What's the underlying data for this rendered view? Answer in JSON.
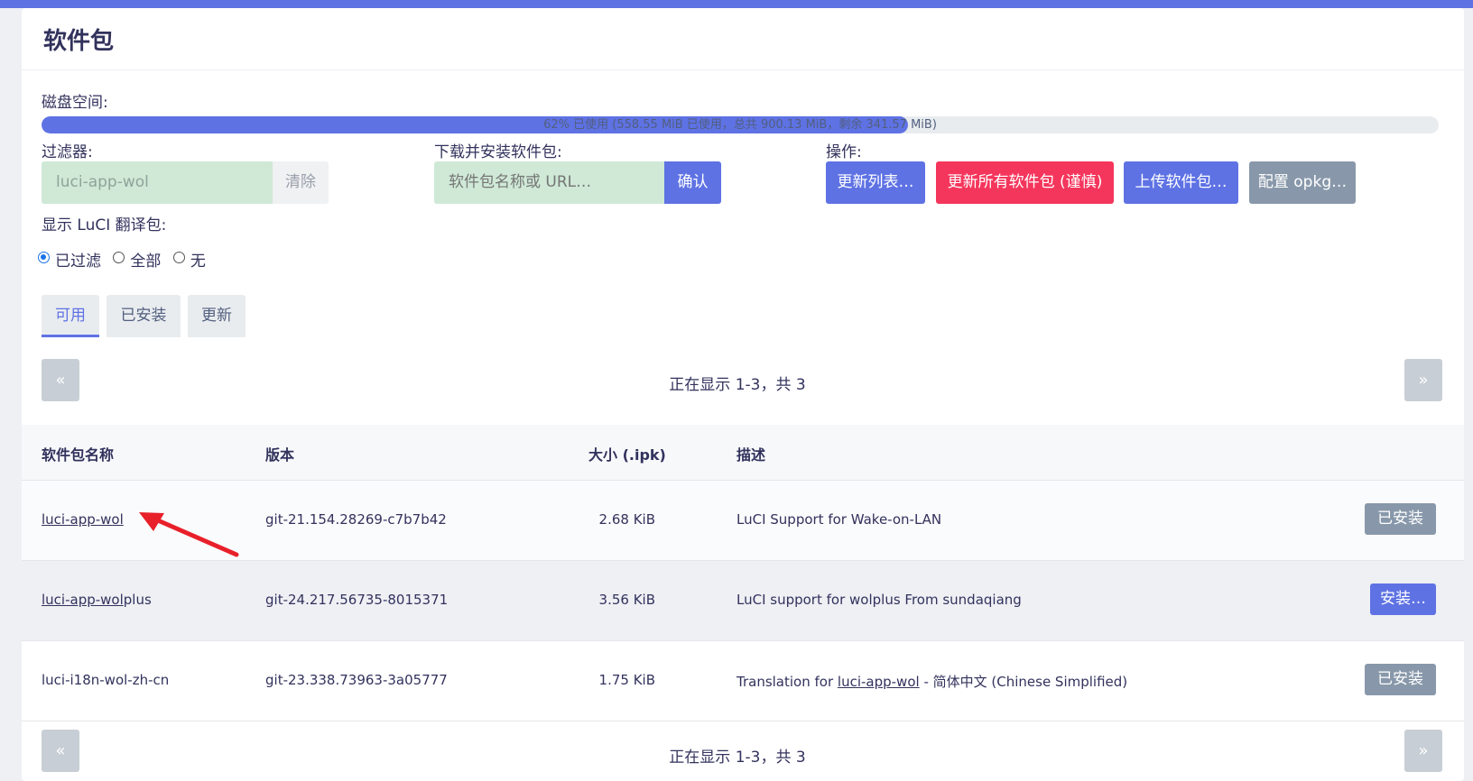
{
  "page": {
    "title": "软件包"
  },
  "disk": {
    "label": "磁盘空间:",
    "used_fraction": 0.62,
    "text": "62% 已使用 (558.55 MiB 已使用，总共 900.13 MiB，剩余 341.57 MiB)"
  },
  "filter": {
    "label": "过滤器:",
    "value": "luci-app-wol",
    "clear_label": "清除"
  },
  "download": {
    "label": "下载并安装软件包:",
    "placeholder": "软件包名称或 URL…",
    "confirm_label": "确认"
  },
  "actions": {
    "label": "操作:",
    "update_lists": "更新列表…",
    "upgrade_all": "更新所有软件包 (谨慎)",
    "upload": "上传软件包…",
    "configure": "配置 opkg…"
  },
  "translations": {
    "label": "显示 LuCI 翻译包:",
    "options": [
      "已过滤",
      "全部",
      "无"
    ],
    "selected": "已过滤"
  },
  "tabs": [
    "可用",
    "已安装",
    "更新"
  ],
  "active_tab": "可用",
  "pager": {
    "prev": "«",
    "next": "»",
    "status": "正在显示 1-3，共 3"
  },
  "table": {
    "headers": [
      "软件包名称",
      "版本",
      "大小 (.ipk)",
      "描述"
    ],
    "rows": [
      {
        "name": "luci-app-wol",
        "version": "git-21.154.28269-c7b7b42",
        "size": "2.68 KiB",
        "description": "LuCI Support for Wake-on-LAN",
        "action": "已安装"
      },
      {
        "name_prefix": "luci-app-wol",
        "name_suffix": "plus",
        "version": "git-24.217.56735-8015371",
        "size": "3.56 KiB",
        "description": "LuCI support for wolplus From sundaqiang",
        "action": "安装…"
      },
      {
        "name": "luci-i18n-wol-zh-cn",
        "version": "git-23.338.73963-3a05777",
        "size": "1.75 KiB",
        "description_prefix": "Translation for ",
        "description_link": "luci-app-wol",
        "description_suffix": " - 简体中文 (Chinese Simplified)",
        "action": "已安装"
      }
    ]
  },
  "colors": {
    "primary": "#5e72e4",
    "danger": "#f5365c",
    "secondary": "#8898aa",
    "annotation_arrow": "#e8202a"
  }
}
